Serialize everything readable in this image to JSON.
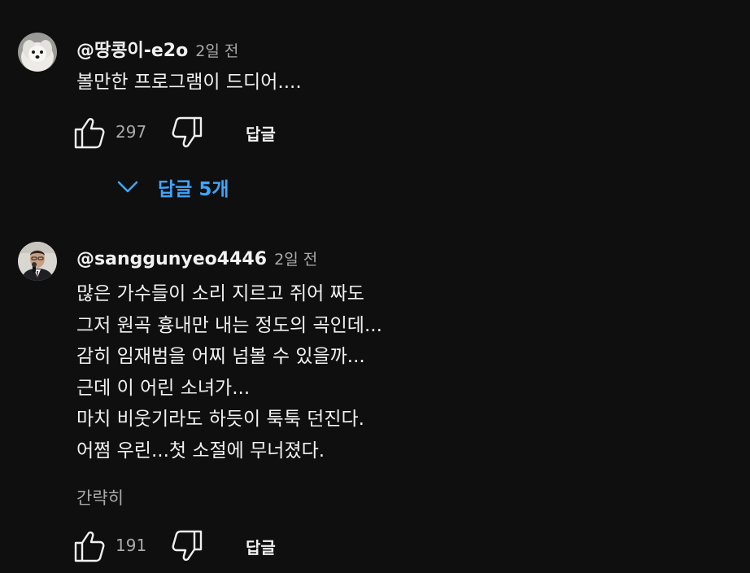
{
  "comments": [
    {
      "author": "@땅콩이-e2o",
      "time": "2일 전",
      "lines": [
        "볼만한 프로그램이 드디어...."
      ],
      "avatar_icon": "white-dog-avatar",
      "likes": "297",
      "reply_label": "답글",
      "replies_label": "답글 5개"
    },
    {
      "author": "@sanggunyeo4446",
      "time": "2일 전",
      "lines": [
        "많은 가수들이 소리 지르고 쥐어 짜도",
        "그저 원곡 흉내만 내는 정도의 곡인데...",
        "감히 임재범을 어찌 넘볼 수 있을까...",
        "근데 이 어린 소녀가...",
        "마치 비웃기라도 하듯이 툭툭 던진다.",
        "어쩜 우린...첫 소절에 무너졌다."
      ],
      "collapse_label": "간략히",
      "avatar_icon": "man-with-microphone-avatar",
      "likes": "191",
      "reply_label": "답글"
    }
  ],
  "colors": {
    "background": "#0f0f0f",
    "primary_text": "#f1f1f1",
    "secondary_text": "#aaaaaa",
    "link_blue": "#3ea6ff"
  }
}
